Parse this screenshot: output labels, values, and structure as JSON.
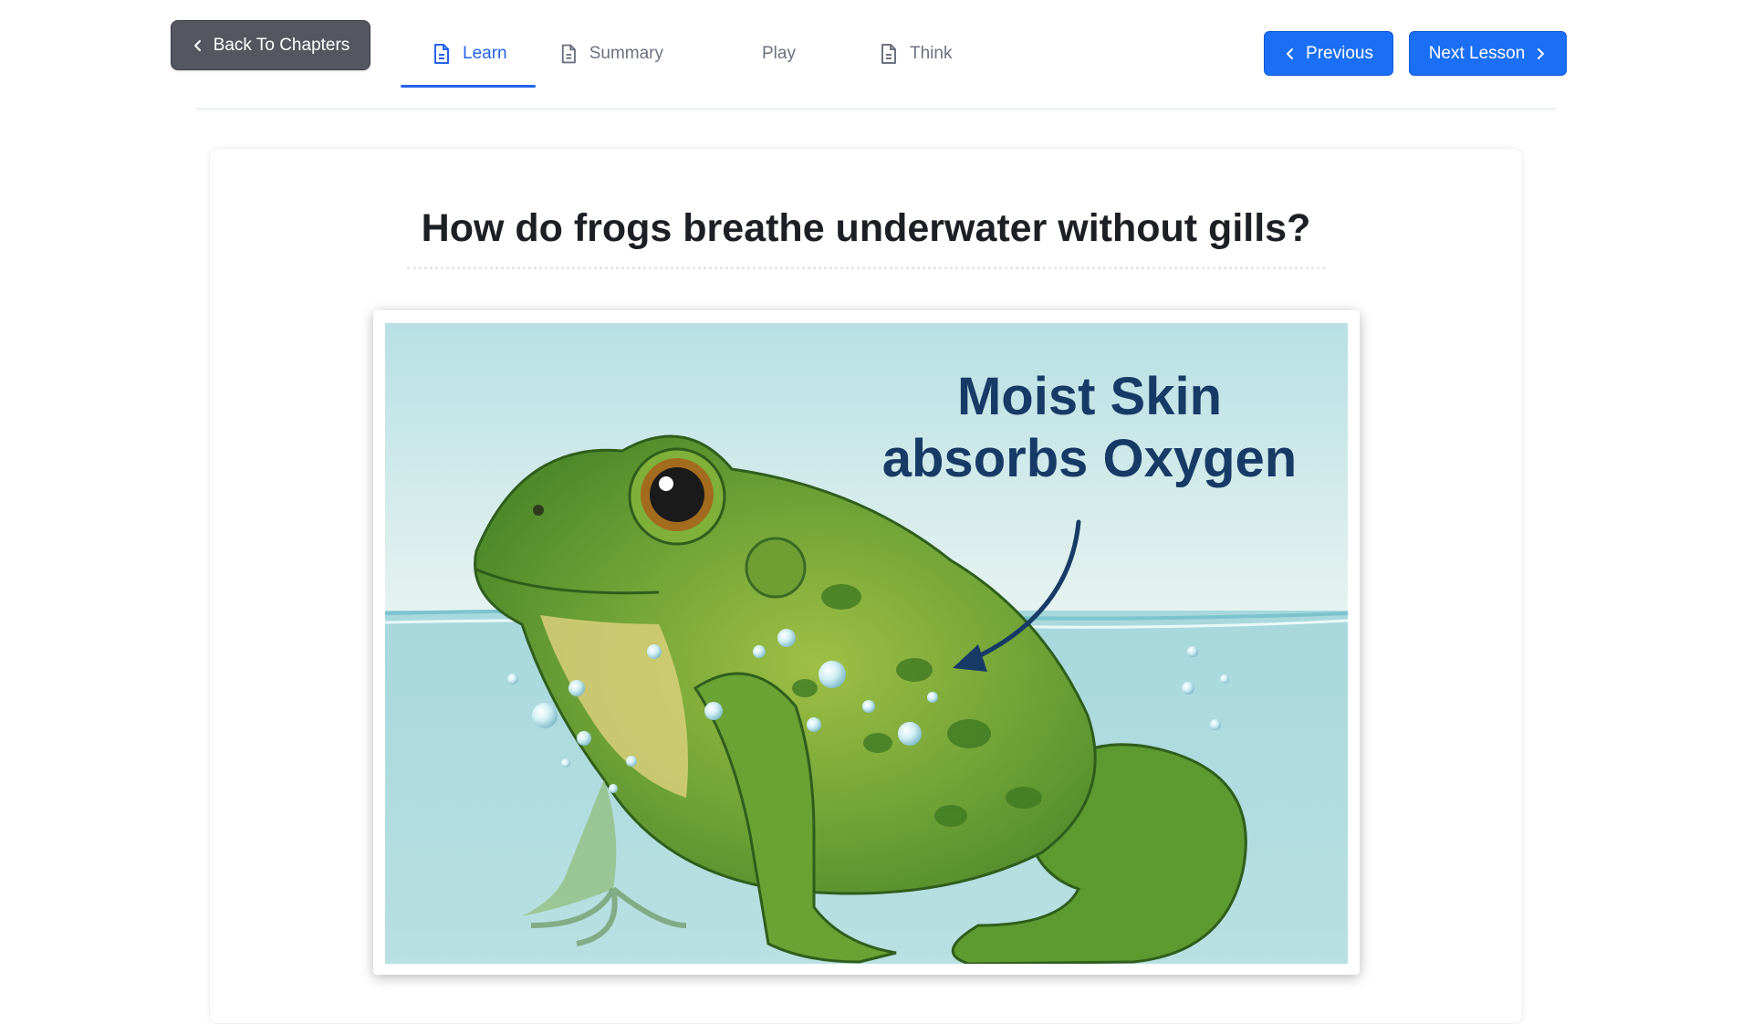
{
  "nav": {
    "back_label": "Back To Chapters",
    "tabs": [
      {
        "label": "Learn",
        "icon": "document-icon",
        "active": true
      },
      {
        "label": "Summary",
        "icon": "document-icon",
        "active": false
      },
      {
        "label": "Play",
        "icon": "clipboard-icon",
        "active": false
      },
      {
        "label": "Think",
        "icon": "document-icon",
        "active": false
      }
    ],
    "previous_label": "Previous",
    "next_label": "Next Lesson"
  },
  "lesson": {
    "question": "How do frogs breathe underwater without gills?",
    "illustration": {
      "caption_line1": "Moist Skin",
      "caption_line2": "absorbs Oxygen"
    }
  },
  "colors": {
    "accent": "#1a6ff5",
    "back_button": "#545760",
    "caption": "#173a66",
    "water": "#a9d9dc",
    "sky": "#cbe9ec",
    "frog": "#5f9a2e"
  }
}
